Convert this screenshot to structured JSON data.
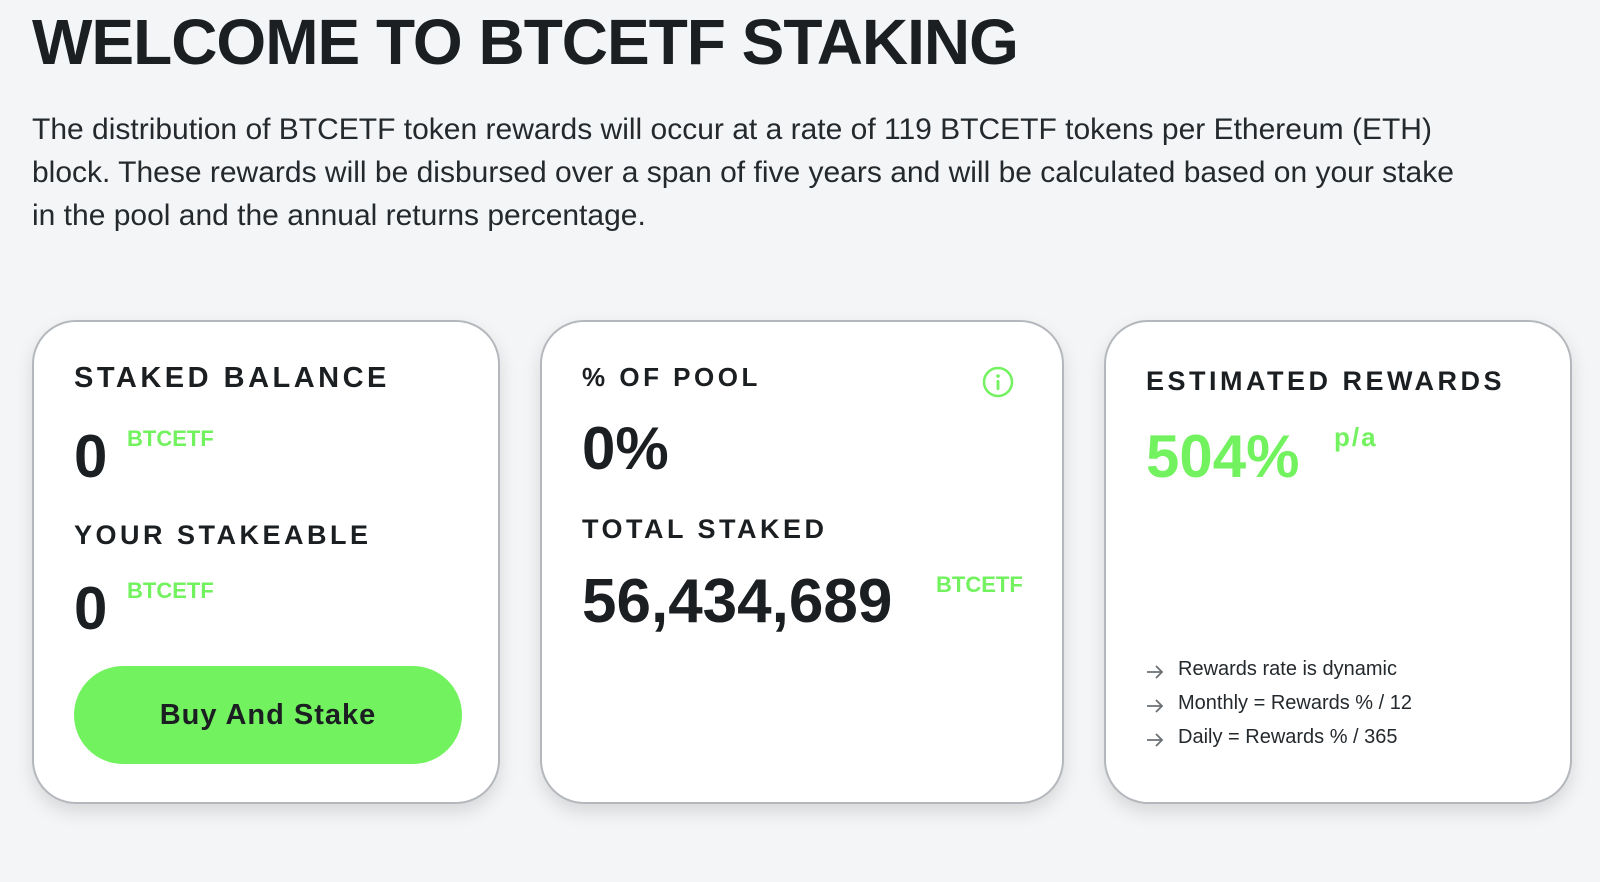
{
  "header": {
    "title": "WELCOME TO BTCETF STAKING",
    "description": "The distribution of BTCETF token rewards will occur at a rate of 119 BTCETF tokens per Ethereum (ETH) block. These rewards will be disbursed over a span of five years and will be calculated based on your stake in the pool and the annual returns percentage."
  },
  "balance_card": {
    "staked_label": "STAKED BALANCE",
    "staked_value": "0",
    "staked_unit": "BTCETF",
    "stakeable_label": "YOUR STAKEABLE",
    "stakeable_value": "0",
    "stakeable_unit": "BTCETF",
    "button_label": "Buy And Stake"
  },
  "pool_card": {
    "pool_label": "% OF POOL",
    "pool_value": "0%",
    "info_icon": "info-circle-icon",
    "total_label": "TOTAL STAKED",
    "total_value": "56,434,689",
    "total_unit": "BTCETF"
  },
  "rewards_card": {
    "label": "ESTIMATED REWARDS",
    "value": "504%",
    "unit": "p/a",
    "notes": [
      "Rewards rate is dynamic",
      "Monthly = Rewards % / 12",
      "Daily = Rewards % / 365"
    ],
    "note_icon": "arrow-right-icon"
  },
  "colors": {
    "accent": "#72f25e",
    "text": "#1b1f22",
    "background": "#f4f5f7",
    "card": "#ffffff"
  }
}
